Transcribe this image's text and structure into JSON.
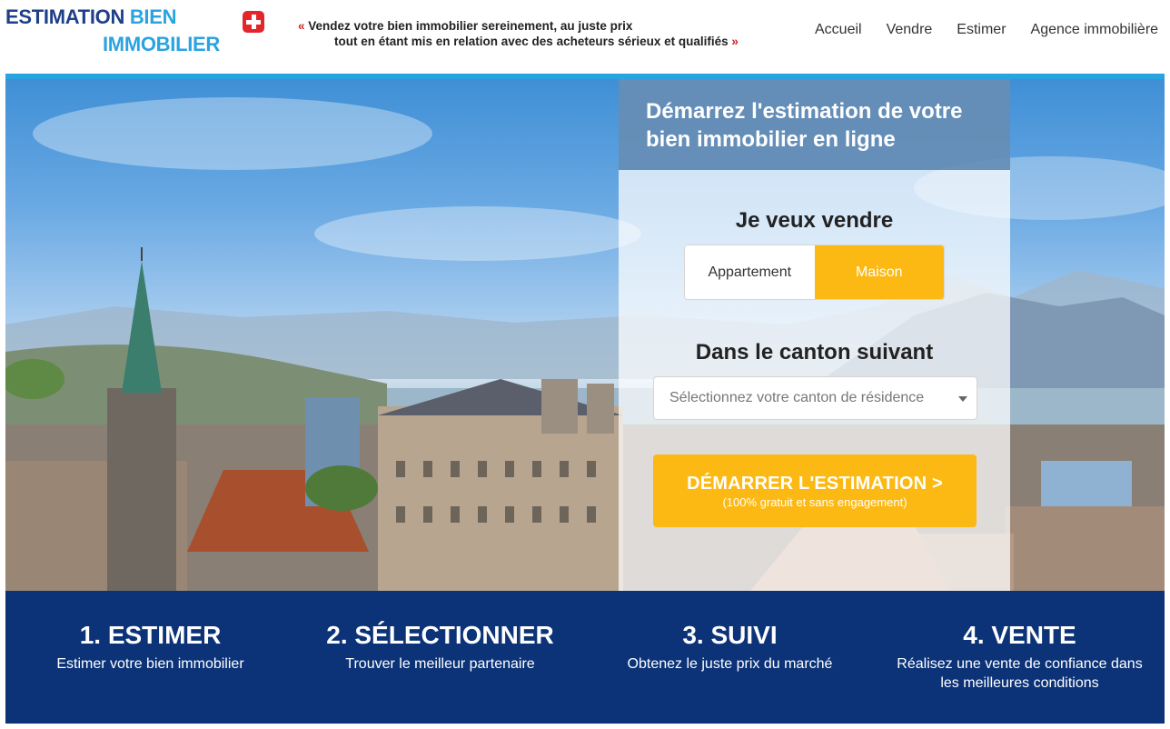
{
  "header": {
    "logo_line1_a": "ESTIMATION",
    "logo_line1_b": "BIEN",
    "logo_line2": "IMMOBILIER",
    "tagline_line1": "Vendez votre bien immobilier sereinement, au juste prix",
    "tagline_line2": "tout en étant mis en relation avec des acheteurs sérieux et qualifiés",
    "quote_open": "«",
    "quote_close": "»",
    "nav": [
      "Accueil",
      "Vendre",
      "Estimer",
      "Agence immobilière"
    ]
  },
  "form": {
    "title": "Démarrez l'estimation de votre bien immobilier en ligne",
    "question1": "Je veux vendre",
    "options": [
      "Appartement",
      "Maison"
    ],
    "selected_option": "Maison",
    "question2": "Dans le canton suivant",
    "select_placeholder": "Sélectionnez votre canton de résidence",
    "cta_label": "DÉMARRER L'ESTIMATION >",
    "cta_sub": "(100% gratuit et sans engagement)"
  },
  "steps": [
    {
      "title": "1. ESTIMER",
      "desc": "Estimer votre bien immobilier"
    },
    {
      "title": "2. SÉLECTIONNER",
      "desc": "Trouver le meilleur partenaire"
    },
    {
      "title": "3. SUIVI",
      "desc": "Obtenez le juste prix du marché"
    },
    {
      "title": "4. VENTE",
      "desc": "Réalisez une vente de confiance dans les meilleures conditions"
    }
  ],
  "colors": {
    "brand_dark_blue": "#1f3f8a",
    "brand_light_blue": "#2aa4e0",
    "accent_yellow": "#fdb913",
    "steps_band": "#0c3378",
    "swiss_red": "#e3262b"
  },
  "icons": [
    "swiss-flag-icon",
    "chevron-down-icon"
  ]
}
